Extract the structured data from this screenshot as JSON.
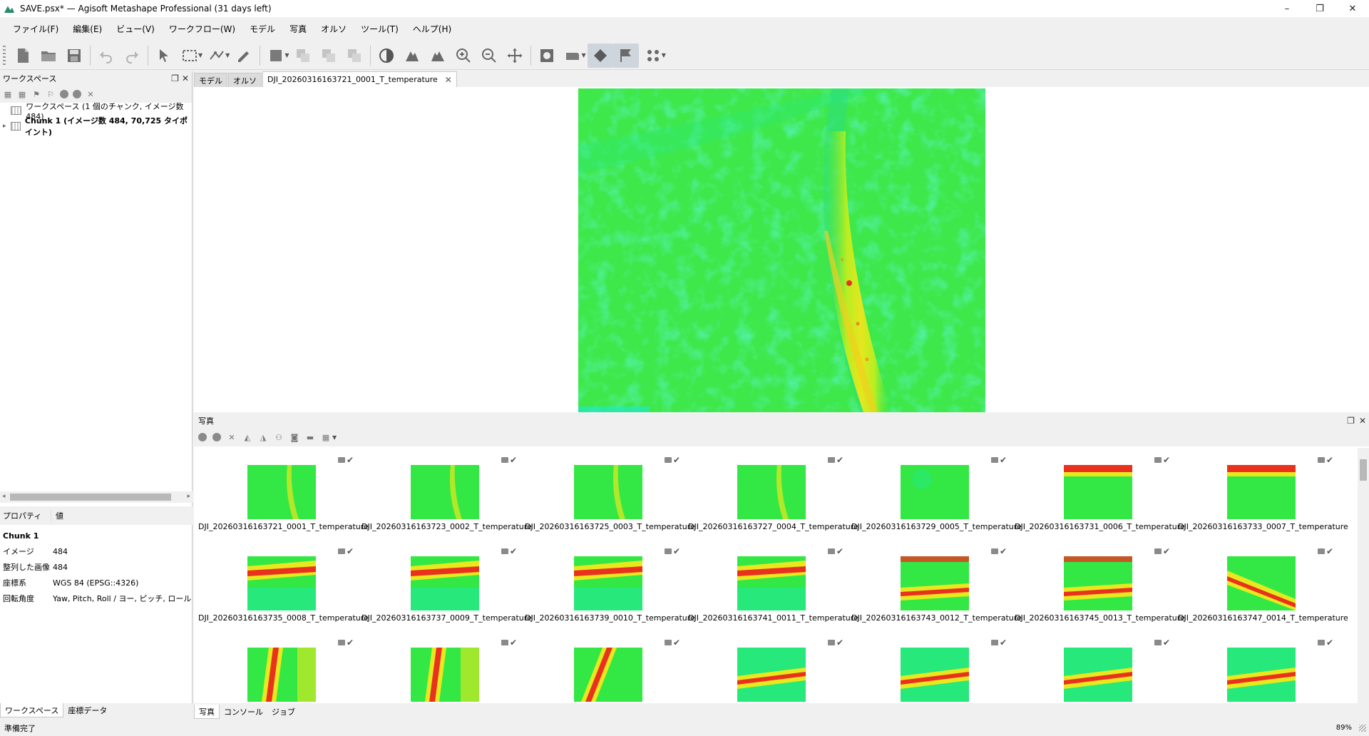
{
  "window": {
    "title": "SAVE.psx* — Agisoft Metashape Professional (31 days left)",
    "controls": [
      "–",
      "❐",
      "✕"
    ]
  },
  "menu": [
    {
      "label": "ファイル(F)"
    },
    {
      "label": "編集(E)"
    },
    {
      "label": "ビュー(V)"
    },
    {
      "label": "ワークフロー(W)"
    },
    {
      "label": "モデル"
    },
    {
      "label": "写真"
    },
    {
      "label": "オルソ"
    },
    {
      "label": "ツール(T)"
    },
    {
      "label": "ヘルプ(H)"
    }
  ],
  "workspace": {
    "panel_title": "ワークスペース",
    "root_label": "ワークスペース (1 個のチャンク, イメージ数 484)",
    "chunk_label": "Chunk 1 (イメージ数 484, 70,725 タイポイント)"
  },
  "properties": {
    "col_property": "プロパティ",
    "col_value": "値",
    "heading": "Chunk 1",
    "rows": [
      {
        "key": "イメージ",
        "value": "484"
      },
      {
        "key": "整列した画像",
        "value": "484"
      },
      {
        "key": "座標系",
        "value": "WGS 84 (EPSG::4326)"
      },
      {
        "key": "回転角度",
        "value": "Yaw, Pitch, Roll / ヨー, ピッチ, ロール"
      }
    ]
  },
  "left_tabs": [
    "ワークスペース",
    "座標データ"
  ],
  "doc_tabs": [
    {
      "label": "モデル"
    },
    {
      "label": "オルソ"
    },
    {
      "label": "DJI_20260316163721_0001_T_temperature"
    }
  ],
  "photos": {
    "panel_title": "写真",
    "items": [
      {
        "name": "DJI_20260316163721_0001_T_temperature",
        "style": "stripe-v"
      },
      {
        "name": "DJI_20260316163723_0002_T_temperature",
        "style": "stripe-v"
      },
      {
        "name": "DJI_20260316163725_0003_T_temperature",
        "style": "stripe-v"
      },
      {
        "name": "DJI_20260316163727_0004_T_temperature",
        "style": "stripe-v"
      },
      {
        "name": "DJI_20260316163729_0005_T_temperature",
        "style": "plain"
      },
      {
        "name": "DJI_20260316163731_0006_T_temperature",
        "style": "top-hot"
      },
      {
        "name": "DJI_20260316163733_0007_T_temperature",
        "style": "top-hot"
      },
      {
        "name": "DJI_20260316163735_0008_T_temperature",
        "style": "band-h"
      },
      {
        "name": "DJI_20260316163737_0009_T_temperature",
        "style": "band-h"
      },
      {
        "name": "DJI_20260316163739_0010_T_temperature",
        "style": "band-h"
      },
      {
        "name": "DJI_20260316163741_0011_T_temperature",
        "style": "band-h"
      },
      {
        "name": "DJI_20260316163743_0012_T_temperature",
        "style": "band-h2"
      },
      {
        "name": "DJI_20260316163745_0013_T_temperature",
        "style": "band-h2"
      },
      {
        "name": "DJI_20260316163747_0014_T_temperature",
        "style": "band-diag"
      },
      {
        "name": "",
        "style": "band-v"
      },
      {
        "name": "",
        "style": "band-v"
      },
      {
        "name": "",
        "style": "band-v2"
      },
      {
        "name": "",
        "style": "band-h3"
      },
      {
        "name": "",
        "style": "band-h3"
      },
      {
        "name": "",
        "style": "band-h3"
      },
      {
        "name": "",
        "style": "band-h3"
      }
    ]
  },
  "bottom_tabs": [
    "写真",
    "コンソール",
    "ジョブ"
  ],
  "status": {
    "text": "準備完了",
    "zoom": "89%"
  },
  "colors": {
    "thermal_base": "#33e845",
    "thermal_cool": "#1ee8a0",
    "thermal_warm": "#e8e81e",
    "thermal_hot": "#e8321e"
  }
}
